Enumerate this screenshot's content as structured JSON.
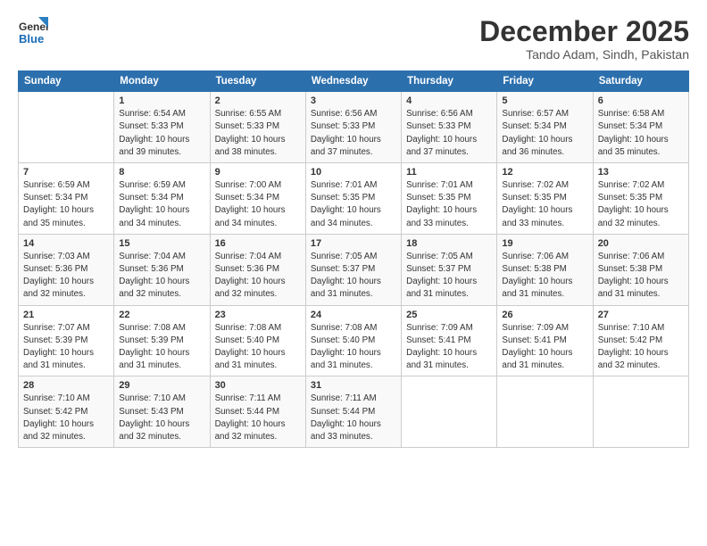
{
  "header": {
    "logo_line1": "General",
    "logo_line2": "Blue",
    "title": "December 2025",
    "subtitle": "Tando Adam, Sindh, Pakistan"
  },
  "columns": [
    "Sunday",
    "Monday",
    "Tuesday",
    "Wednesday",
    "Thursday",
    "Friday",
    "Saturday"
  ],
  "weeks": [
    [
      {
        "day": "",
        "info": ""
      },
      {
        "day": "1",
        "info": "Sunrise: 6:54 AM\nSunset: 5:33 PM\nDaylight: 10 hours\nand 39 minutes."
      },
      {
        "day": "2",
        "info": "Sunrise: 6:55 AM\nSunset: 5:33 PM\nDaylight: 10 hours\nand 38 minutes."
      },
      {
        "day": "3",
        "info": "Sunrise: 6:56 AM\nSunset: 5:33 PM\nDaylight: 10 hours\nand 37 minutes."
      },
      {
        "day": "4",
        "info": "Sunrise: 6:56 AM\nSunset: 5:33 PM\nDaylight: 10 hours\nand 37 minutes."
      },
      {
        "day": "5",
        "info": "Sunrise: 6:57 AM\nSunset: 5:34 PM\nDaylight: 10 hours\nand 36 minutes."
      },
      {
        "day": "6",
        "info": "Sunrise: 6:58 AM\nSunset: 5:34 PM\nDaylight: 10 hours\nand 35 minutes."
      }
    ],
    [
      {
        "day": "7",
        "info": "Sunrise: 6:59 AM\nSunset: 5:34 PM\nDaylight: 10 hours\nand 35 minutes."
      },
      {
        "day": "8",
        "info": "Sunrise: 6:59 AM\nSunset: 5:34 PM\nDaylight: 10 hours\nand 34 minutes."
      },
      {
        "day": "9",
        "info": "Sunrise: 7:00 AM\nSunset: 5:34 PM\nDaylight: 10 hours\nand 34 minutes."
      },
      {
        "day": "10",
        "info": "Sunrise: 7:01 AM\nSunset: 5:35 PM\nDaylight: 10 hours\nand 34 minutes."
      },
      {
        "day": "11",
        "info": "Sunrise: 7:01 AM\nSunset: 5:35 PM\nDaylight: 10 hours\nand 33 minutes."
      },
      {
        "day": "12",
        "info": "Sunrise: 7:02 AM\nSunset: 5:35 PM\nDaylight: 10 hours\nand 33 minutes."
      },
      {
        "day": "13",
        "info": "Sunrise: 7:02 AM\nSunset: 5:35 PM\nDaylight: 10 hours\nand 32 minutes."
      }
    ],
    [
      {
        "day": "14",
        "info": "Sunrise: 7:03 AM\nSunset: 5:36 PM\nDaylight: 10 hours\nand 32 minutes."
      },
      {
        "day": "15",
        "info": "Sunrise: 7:04 AM\nSunset: 5:36 PM\nDaylight: 10 hours\nand 32 minutes."
      },
      {
        "day": "16",
        "info": "Sunrise: 7:04 AM\nSunset: 5:36 PM\nDaylight: 10 hours\nand 32 minutes."
      },
      {
        "day": "17",
        "info": "Sunrise: 7:05 AM\nSunset: 5:37 PM\nDaylight: 10 hours\nand 31 minutes."
      },
      {
        "day": "18",
        "info": "Sunrise: 7:05 AM\nSunset: 5:37 PM\nDaylight: 10 hours\nand 31 minutes."
      },
      {
        "day": "19",
        "info": "Sunrise: 7:06 AM\nSunset: 5:38 PM\nDaylight: 10 hours\nand 31 minutes."
      },
      {
        "day": "20",
        "info": "Sunrise: 7:06 AM\nSunset: 5:38 PM\nDaylight: 10 hours\nand 31 minutes."
      }
    ],
    [
      {
        "day": "21",
        "info": "Sunrise: 7:07 AM\nSunset: 5:39 PM\nDaylight: 10 hours\nand 31 minutes."
      },
      {
        "day": "22",
        "info": "Sunrise: 7:08 AM\nSunset: 5:39 PM\nDaylight: 10 hours\nand 31 minutes."
      },
      {
        "day": "23",
        "info": "Sunrise: 7:08 AM\nSunset: 5:40 PM\nDaylight: 10 hours\nand 31 minutes."
      },
      {
        "day": "24",
        "info": "Sunrise: 7:08 AM\nSunset: 5:40 PM\nDaylight: 10 hours\nand 31 minutes."
      },
      {
        "day": "25",
        "info": "Sunrise: 7:09 AM\nSunset: 5:41 PM\nDaylight: 10 hours\nand 31 minutes."
      },
      {
        "day": "26",
        "info": "Sunrise: 7:09 AM\nSunset: 5:41 PM\nDaylight: 10 hours\nand 31 minutes."
      },
      {
        "day": "27",
        "info": "Sunrise: 7:10 AM\nSunset: 5:42 PM\nDaylight: 10 hours\nand 32 minutes."
      }
    ],
    [
      {
        "day": "28",
        "info": "Sunrise: 7:10 AM\nSunset: 5:42 PM\nDaylight: 10 hours\nand 32 minutes."
      },
      {
        "day": "29",
        "info": "Sunrise: 7:10 AM\nSunset: 5:43 PM\nDaylight: 10 hours\nand 32 minutes."
      },
      {
        "day": "30",
        "info": "Sunrise: 7:11 AM\nSunset: 5:44 PM\nDaylight: 10 hours\nand 32 minutes."
      },
      {
        "day": "31",
        "info": "Sunrise: 7:11 AM\nSunset: 5:44 PM\nDaylight: 10 hours\nand 33 minutes."
      },
      {
        "day": "",
        "info": ""
      },
      {
        "day": "",
        "info": ""
      },
      {
        "day": "",
        "info": ""
      }
    ]
  ]
}
